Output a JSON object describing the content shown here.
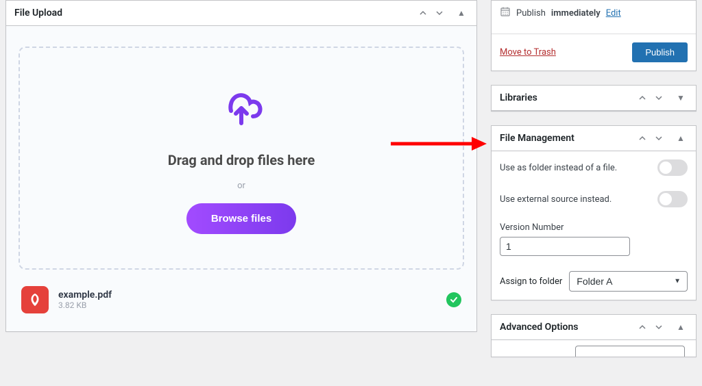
{
  "upload": {
    "title": "File Upload",
    "drag_text": "Drag and drop files here",
    "or_text": "or",
    "browse_label": "Browse files",
    "file": {
      "name": "example.pdf",
      "size": "3.82 KB"
    }
  },
  "publish": {
    "publish_label": "Publish",
    "publish_value": "immediately",
    "edit_link": "Edit",
    "trash_label": "Move to Trash",
    "button_label": "Publish"
  },
  "libraries": {
    "title": "Libraries"
  },
  "file_mgmt": {
    "title": "File Management",
    "use_folder_label": "Use as folder instead of a file.",
    "use_external_label": "Use external source instead.",
    "version_label": "Version Number",
    "version_value": "1",
    "assign_label": "Assign to folder",
    "folder_value": "Folder A"
  },
  "advanced": {
    "title": "Advanced Options"
  }
}
